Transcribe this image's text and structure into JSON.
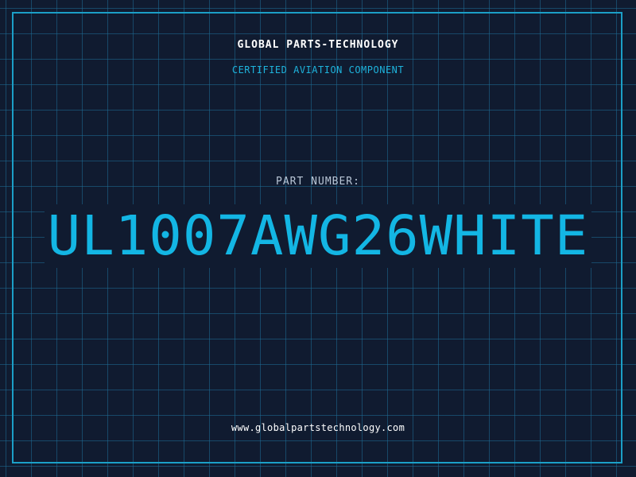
{
  "header": {
    "company_name": "GLOBAL PARTS-TECHNOLOGY",
    "tagline": "CERTIFIED AVIATION COMPONENT"
  },
  "part": {
    "label": "PART NUMBER:",
    "number": "UL1007AWG26WHITE"
  },
  "footer": {
    "website": "www.globalpartstechnology.com"
  },
  "colors": {
    "background": "#101b30",
    "grid": "#1e6e96",
    "accent": "#1b9fc7",
    "part_number": "#13b6e4",
    "text": "#ffffff"
  }
}
